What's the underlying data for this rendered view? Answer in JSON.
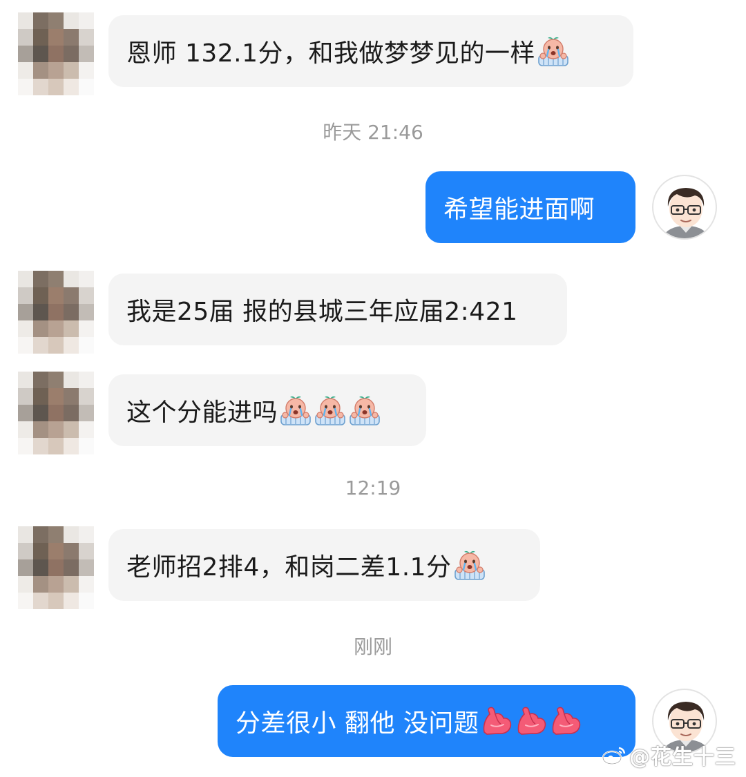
{
  "messages": [
    {
      "side": "in",
      "text": "恩师 132.1分，和我做梦梦见的一样",
      "emoji": [
        "crying-face-icon"
      ]
    },
    {
      "timestamp": "昨天 21:46"
    },
    {
      "side": "out",
      "text": "希望能进面啊"
    },
    {
      "side": "in",
      "text": "我是25届 报的县城三年应届2:421"
    },
    {
      "side": "in",
      "text": "这个分能进吗",
      "emoji": [
        "crying-face-icon",
        "crying-face-icon",
        "crying-face-icon"
      ]
    },
    {
      "timestamp": "12:19"
    },
    {
      "side": "in",
      "text": "老师招2排4，和岗二差1.1分",
      "emoji": [
        "crying-face-icon"
      ]
    },
    {
      "timestamp": "刚刚"
    },
    {
      "side": "out",
      "text": "分差很小 翻他 没问题",
      "emoji": [
        "flexed-biceps-icon",
        "flexed-biceps-icon",
        "flexed-biceps-icon"
      ]
    }
  ],
  "watermark": "@花生十三",
  "colors": {
    "outgoing_bubble": "#1f84fb",
    "incoming_bubble": "#f4f4f4",
    "timestamp": "#9a9a9a"
  }
}
